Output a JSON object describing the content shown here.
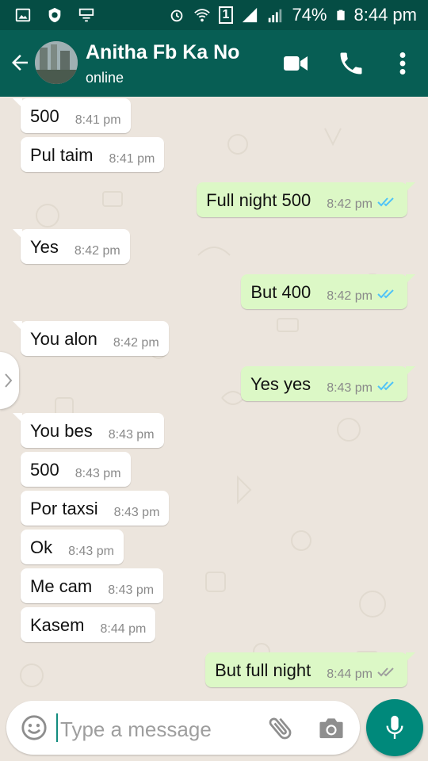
{
  "status_bar": {
    "battery": "74%",
    "time": "8:44 pm",
    "sim": "1"
  },
  "header": {
    "contact_name": "Anitha Fb Ka No",
    "status": "online"
  },
  "messages": [
    {
      "dir": "in",
      "text": "500",
      "time": "8:41 pm"
    },
    {
      "dir": "in",
      "text": "Pul taim",
      "time": "8:41 pm"
    },
    {
      "dir": "out",
      "text": "Full night 500",
      "time": "8:42 pm",
      "ticks": "read"
    },
    {
      "dir": "in",
      "text": "Yes",
      "time": "8:42 pm"
    },
    {
      "dir": "out",
      "text": "But 400",
      "time": "8:42 pm",
      "ticks": "read"
    },
    {
      "dir": "in",
      "text": "You alon",
      "time": "8:42 pm"
    },
    {
      "dir": "out",
      "text": "Yes yes",
      "time": "8:43 pm",
      "ticks": "read"
    },
    {
      "dir": "in",
      "text": "You bes",
      "time": "8:43 pm"
    },
    {
      "dir": "in",
      "text": "500",
      "time": "8:43 pm"
    },
    {
      "dir": "in",
      "text": "Por taxsi",
      "time": "8:43 pm"
    },
    {
      "dir": "in",
      "text": "Ok",
      "time": "8:43 pm"
    },
    {
      "dir": "in",
      "text": "Me cam",
      "time": "8:43 pm"
    },
    {
      "dir": "in",
      "text": "Kasem",
      "time": "8:44 pm"
    },
    {
      "dir": "out",
      "text": "But full night",
      "time": "8:44 pm",
      "ticks": "delivered"
    }
  ],
  "composer": {
    "placeholder": "Type a message"
  },
  "colors": {
    "header": "#075e54",
    "status_bar": "#054d44",
    "outgoing_bubble": "#dcf8c6",
    "incoming_bubble": "#ffffff",
    "read_ticks": "#4fc3f7",
    "mic_button": "#00897b"
  },
  "icons": [
    "back-arrow-icon",
    "video-call-icon",
    "voice-call-icon",
    "more-options-icon",
    "emoji-icon",
    "attach-icon",
    "camera-icon",
    "mic-icon"
  ]
}
